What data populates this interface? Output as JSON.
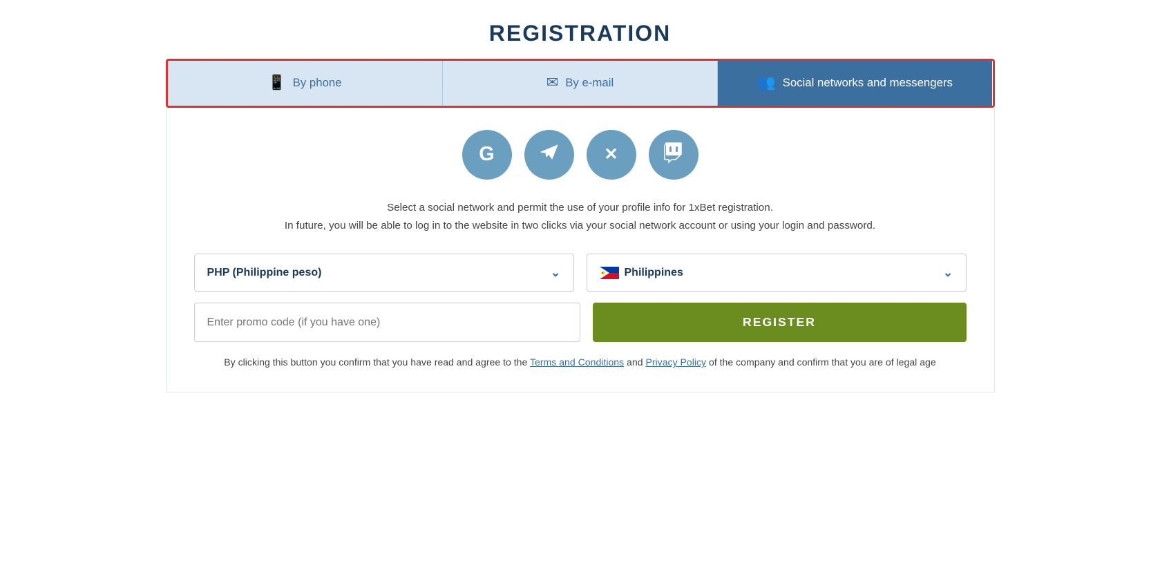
{
  "page": {
    "title": "REGISTRATION"
  },
  "tabs": [
    {
      "id": "by-phone",
      "label": "By phone",
      "icon": "📱",
      "active": false
    },
    {
      "id": "by-email",
      "label": "By e-mail",
      "icon": "✉",
      "active": false
    },
    {
      "id": "social",
      "label": "Social networks and messengers",
      "icon": "👥",
      "active": true
    }
  ],
  "social_networks": [
    {
      "id": "google",
      "label": "G",
      "title": "Google"
    },
    {
      "id": "telegram",
      "label": "✈",
      "title": "Telegram"
    },
    {
      "id": "x",
      "label": "✕",
      "title": "X (Twitter)"
    },
    {
      "id": "twitch",
      "label": "⚡",
      "title": "Twitch"
    }
  ],
  "description": {
    "line1": "Select a social network and permit the use of your profile info for 1xBet registration.",
    "line2": "In future, you will be able to log in to the website in two clicks via your social network account or using your login and password."
  },
  "currency_select": {
    "value": "PHP (Philippine peso)",
    "placeholder": "PHP (Philippine peso)"
  },
  "country_select": {
    "value": "Philippines",
    "flag": "PH"
  },
  "promo_input": {
    "placeholder": "Enter promo code (if you have one)"
  },
  "register_button": {
    "label": "REGISTER"
  },
  "terms": {
    "text_before": "By clicking this button you confirm that you have read and agree to the ",
    "terms_link": "Terms and Conditions",
    "text_and": " and ",
    "privacy_link": "Privacy Policy",
    "text_after": " of the company and confirm that you are of legal age"
  }
}
